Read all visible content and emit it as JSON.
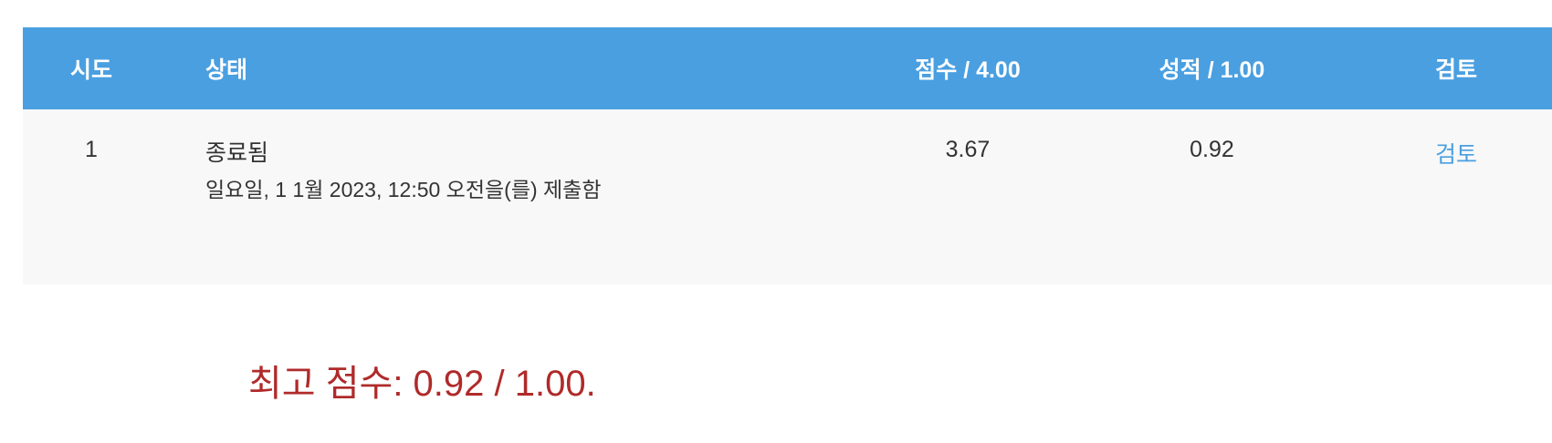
{
  "table": {
    "headers": {
      "attempt": "시도",
      "state": "상태",
      "marks": "점수 / 4.00",
      "grade": "성적 / 1.00",
      "review": "검토"
    },
    "rows": [
      {
        "attempt": "1",
        "state": "종료됨",
        "submitted": "일요일, 1 1월 2023, 12:50 오전을(를) 제출함",
        "marks": "3.67",
        "grade": "0.92",
        "review": "검토"
      }
    ]
  },
  "summary": {
    "best_grade": "최고 점수: 0.92 / 1.00."
  },
  "colors": {
    "header_bg": "#4a9fe0",
    "row_bg": "#f8f8f8",
    "link": "#4a9fe0",
    "best_grade": "#b02a2a"
  }
}
